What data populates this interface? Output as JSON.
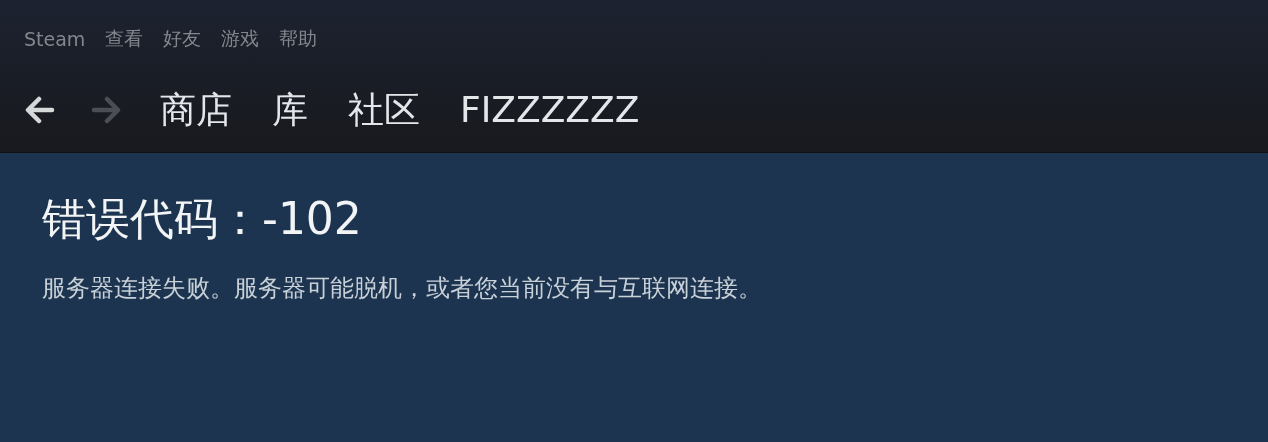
{
  "menu": [
    "Steam",
    "查看",
    "好友",
    "游戏",
    "帮助"
  ],
  "nav": {
    "back": {
      "disabled": false
    },
    "forward": {
      "disabled": true
    },
    "links": [
      "商店",
      "库",
      "社区",
      "FIZZZZZZ"
    ]
  },
  "error": {
    "title": "错误代码：-102",
    "message": "服务器连接失败。服务器可能脱机，或者您当前没有与互联网连接。"
  }
}
